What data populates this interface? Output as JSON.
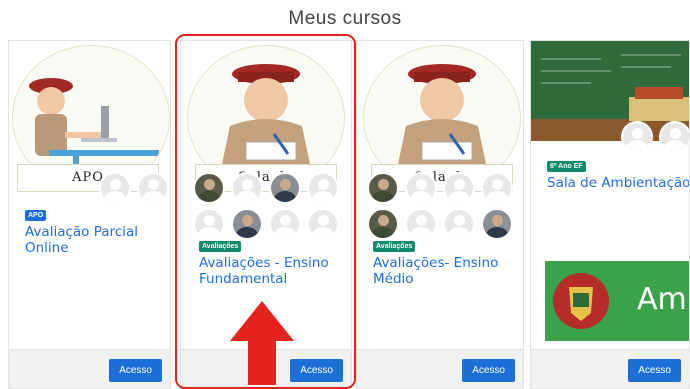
{
  "page": {
    "title": "Meus cursos"
  },
  "courses": [
    {
      "banner_text": "APO",
      "badge": "APO",
      "name": "Avaliação Parcial Online",
      "button": "Acesso"
    },
    {
      "banner_text": "Sala de Avaliações",
      "badge": "Avaliações",
      "name": "Avaliações - Ensino Fundamental",
      "button": "Acesso"
    },
    {
      "banner_text": "Sala de Avaliações",
      "badge": "Avaliações",
      "name": "Avaliações- Ensino Médio",
      "button": "Acesso"
    },
    {
      "badge": "6º Ano EF",
      "name": "Sala de Ambientação",
      "image_text": "Amb",
      "button": "Acesso"
    }
  ],
  "colors": {
    "accent": "#1c6fd6",
    "badge_green": "#0f8a6a",
    "highlight": "#e52420"
  }
}
